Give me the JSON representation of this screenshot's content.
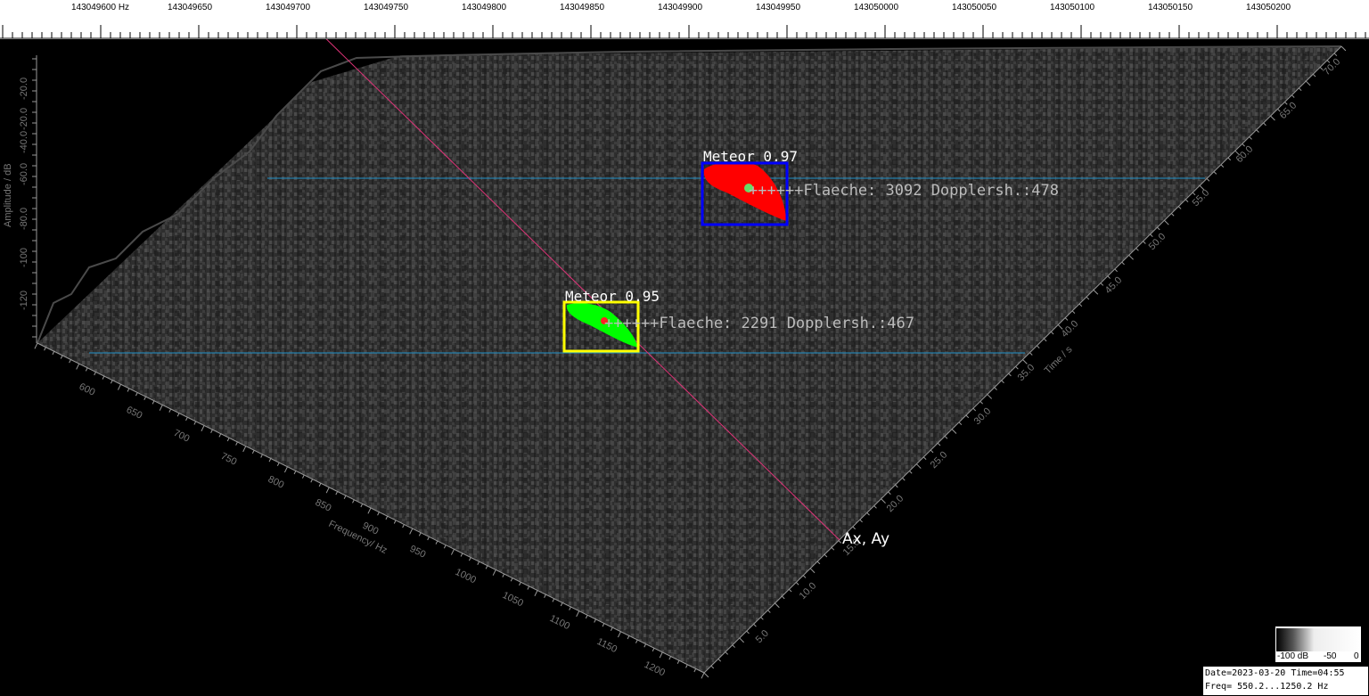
{
  "top_ruler": {
    "labels": [
      "143049600 Hz",
      "143049650",
      "143049700",
      "143049750",
      "143049800",
      "143049850",
      "143049900",
      "143049950",
      "143050000",
      "143050050",
      "143050100",
      "143050150",
      "143050200"
    ]
  },
  "amplitude_axis": {
    "title": "Amplitude / dB",
    "ticks": [
      "-20.0",
      "-20.0",
      "-40.0",
      "-60.0",
      "-80.0",
      "-100",
      "-120"
    ]
  },
  "frequency_axis": {
    "title": "Frequency/ Hz",
    "ticks": [
      "600",
      "650",
      "700",
      "750",
      "800",
      "850",
      "900",
      "950",
      "1000",
      "1050",
      "1100",
      "1150",
      "1200"
    ]
  },
  "time_axis": {
    "title": "Time / s",
    "ticks": [
      "5.0",
      "10.0",
      "15.0",
      "20.0",
      "25.0",
      "30.0",
      "35.0",
      "40.0",
      "45.0",
      "50.0",
      "55.0",
      "60.0",
      "65.0",
      "70.0"
    ]
  },
  "detections": [
    {
      "label": "Meteor 0.97",
      "info": "++++++Flaeche: 3092 Dopplersh.:478",
      "box_color": "#0000ff",
      "blob_color": "#ff0000",
      "dot_color": "#66dd66"
    },
    {
      "label": "Meteor 0.95",
      "info": "++++++Flaeche: 2291 Dopplersh.:467",
      "box_color": "#ffff00",
      "blob_color": "#00ff00",
      "dot_color": "#ff2222"
    }
  ],
  "cursor_label": "Ax, Ay",
  "legend": {
    "min": "-100 dB",
    "mid": "-50",
    "max": "0"
  },
  "info": {
    "line1": "Date=2023-03-20 Time=04:55",
    "line2": "Freq= 550.2...1250.2 Hz"
  },
  "colors": {
    "guide_line": "#1e90c8",
    "cursor_line": "#dd3377",
    "surface": "#3a3a3a"
  }
}
